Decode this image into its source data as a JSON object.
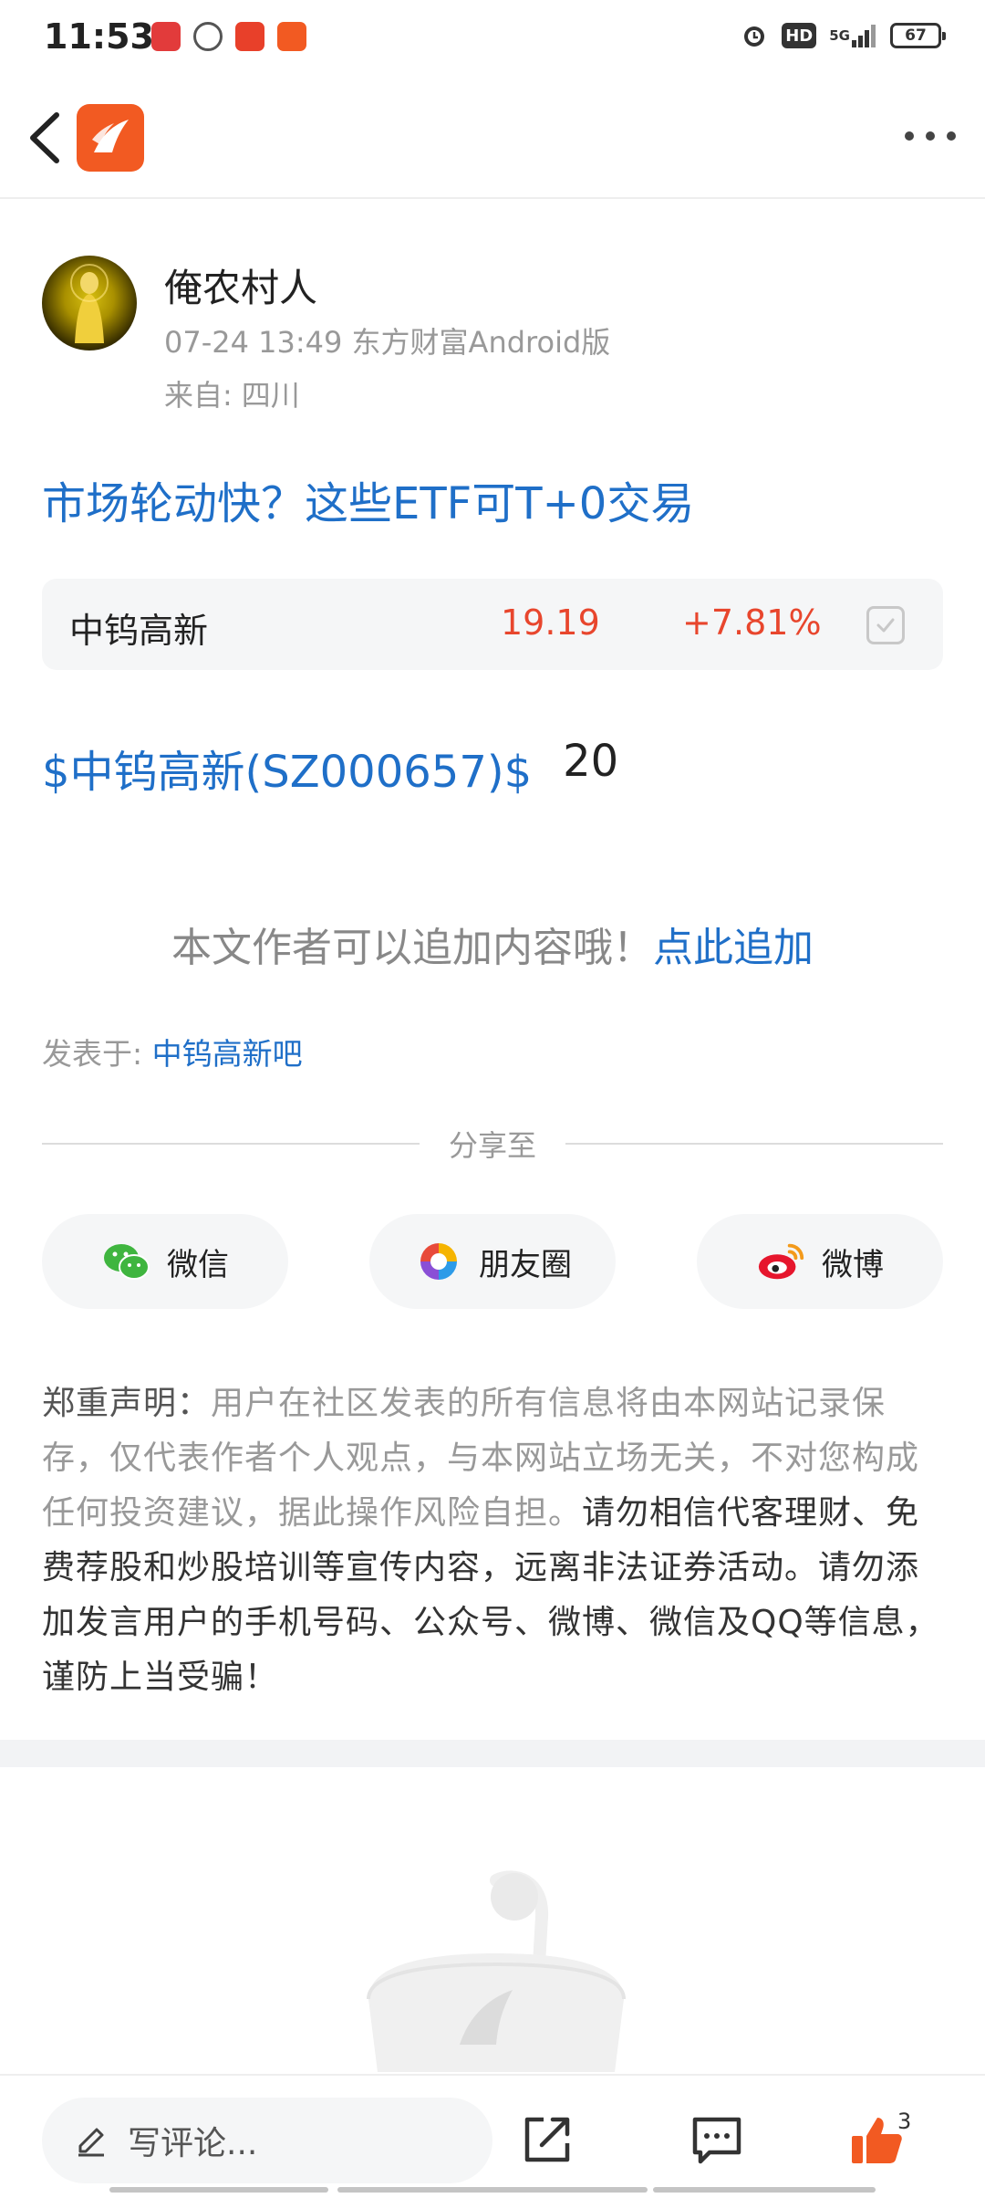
{
  "status": {
    "time": "11:53",
    "battery": "67",
    "network": "5G",
    "hd": "HD"
  },
  "author": {
    "name": "俺农村人",
    "meta": "07-24 13:49 东方财富Android版",
    "from_label": "来自:",
    "from_value": "四川"
  },
  "post": {
    "title": "市场轮动快？这些ETF可T+0交易",
    "body_link": "$中钨高新(SZ000657)$",
    "body_value": "20"
  },
  "stock": {
    "name": "中钨高新",
    "price": "19.19",
    "change": "+7.81%",
    "color": "#e8462d"
  },
  "append": {
    "text": "本文作者可以追加内容哦！",
    "link": "点此追加"
  },
  "posted": {
    "label": "发表于:",
    "link": "中钨高新吧"
  },
  "share": {
    "title": "分享至",
    "buttons": [
      {
        "label": "微信",
        "icon": "wechat-icon"
      },
      {
        "label": "朋友圈",
        "icon": "moments-icon"
      },
      {
        "label": "微博",
        "icon": "weibo-icon"
      }
    ]
  },
  "disclaimer": {
    "head": "郑重声明：",
    "grey": "用户在社区发表的所有信息将由本网站记录保存，仅代表作者个人观点，与本网站立场无关，不对您构成任何投资建议，据此操作风险自担。",
    "dark": "请勿相信代客理财、免费荐股和炒股培训等宣传内容，远离非法证券活动。请勿添加发言用户的手机号码、公众号、微博、微信及QQ等信息，谨防上当受骗！"
  },
  "bottom": {
    "comment_placeholder": "写评论...",
    "like_count": "3"
  },
  "colors": {
    "link": "#1f6fc8",
    "brand": "#f25a22",
    "rise": "#e8462d"
  }
}
